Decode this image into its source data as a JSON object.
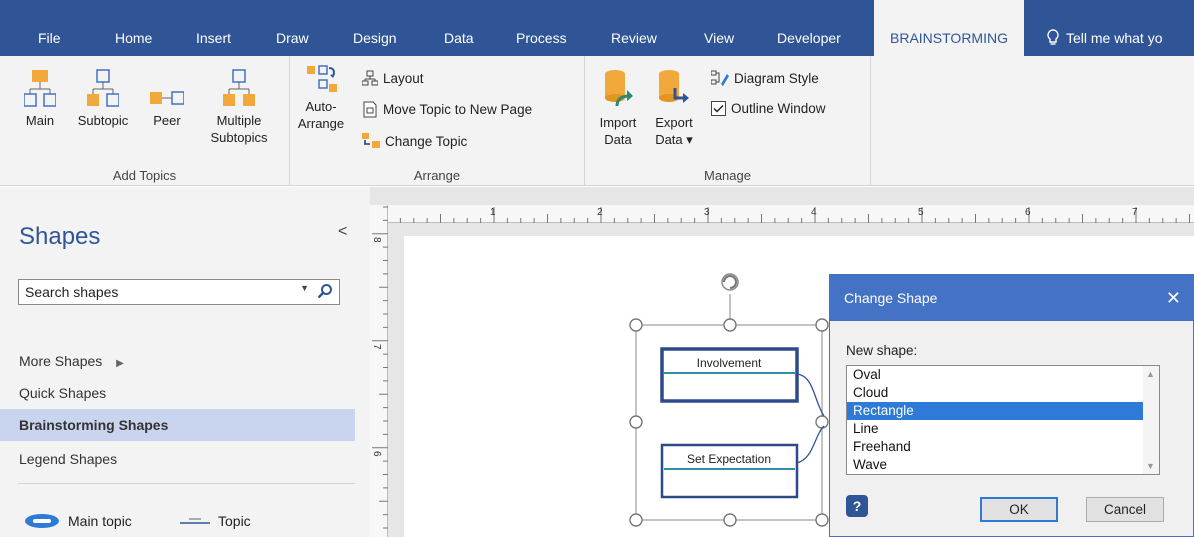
{
  "menu": {
    "tabs": [
      "File",
      "Home",
      "Insert",
      "Draw",
      "Design",
      "Data",
      "Process",
      "Review",
      "View",
      "Developer",
      "BRAINSTORMING"
    ],
    "active_tab": "BRAINSTORMING",
    "tell_me": "Tell me what yo"
  },
  "ribbon": {
    "add_topics": {
      "label": "Add Topics",
      "main": "Main",
      "subtopic": "Subtopic",
      "peer": "Peer",
      "multiple_1": "Multiple",
      "multiple_2": "Subtopics"
    },
    "arrange": {
      "label": "Arrange",
      "auto_1": "Auto-",
      "auto_2": "Arrange",
      "layout": "Layout",
      "move_topic": "Move Topic to New Page",
      "change_topic": "Change Topic"
    },
    "manage": {
      "label": "Manage",
      "import_1": "Import",
      "import_2": "Data",
      "export_1": "Export",
      "export_2": "Data ▾",
      "diagram_style": "Diagram Style",
      "outline_window": "Outline Window",
      "outline_checked": true
    }
  },
  "shapes_pane": {
    "title": "Shapes",
    "collapse": "<",
    "search_placeholder": "Search shapes",
    "items": [
      "More Shapes",
      "Quick Shapes",
      "Brainstorming Shapes",
      "Legend Shapes"
    ],
    "selected_item": "Brainstorming Shapes",
    "stencils": [
      "Main topic",
      "Topic"
    ]
  },
  "rulers": {
    "horizontal": [
      "1",
      "2",
      "3",
      "4",
      "5",
      "6",
      "7"
    ],
    "vertical": [
      "8",
      "7",
      "6"
    ]
  },
  "diagram": {
    "topics": [
      "Involvement",
      "Set Expectation"
    ]
  },
  "dialog": {
    "title": "Change Shape",
    "close": "✕",
    "label": "New shape:",
    "options": [
      "Oval",
      "Cloud",
      "Rectangle",
      "Line",
      "Freehand",
      "Wave"
    ],
    "selected": "Rectangle",
    "help": "?",
    "ok": "OK",
    "cancel": "Cancel"
  },
  "colors": {
    "accent": "#2f5596",
    "dialog_header": "#4472c4",
    "selection": "#2f7ad6",
    "topic_border": "#2e4a8a",
    "topic_line": "#2f8fa8",
    "icon_orange": "#f0a93a"
  }
}
